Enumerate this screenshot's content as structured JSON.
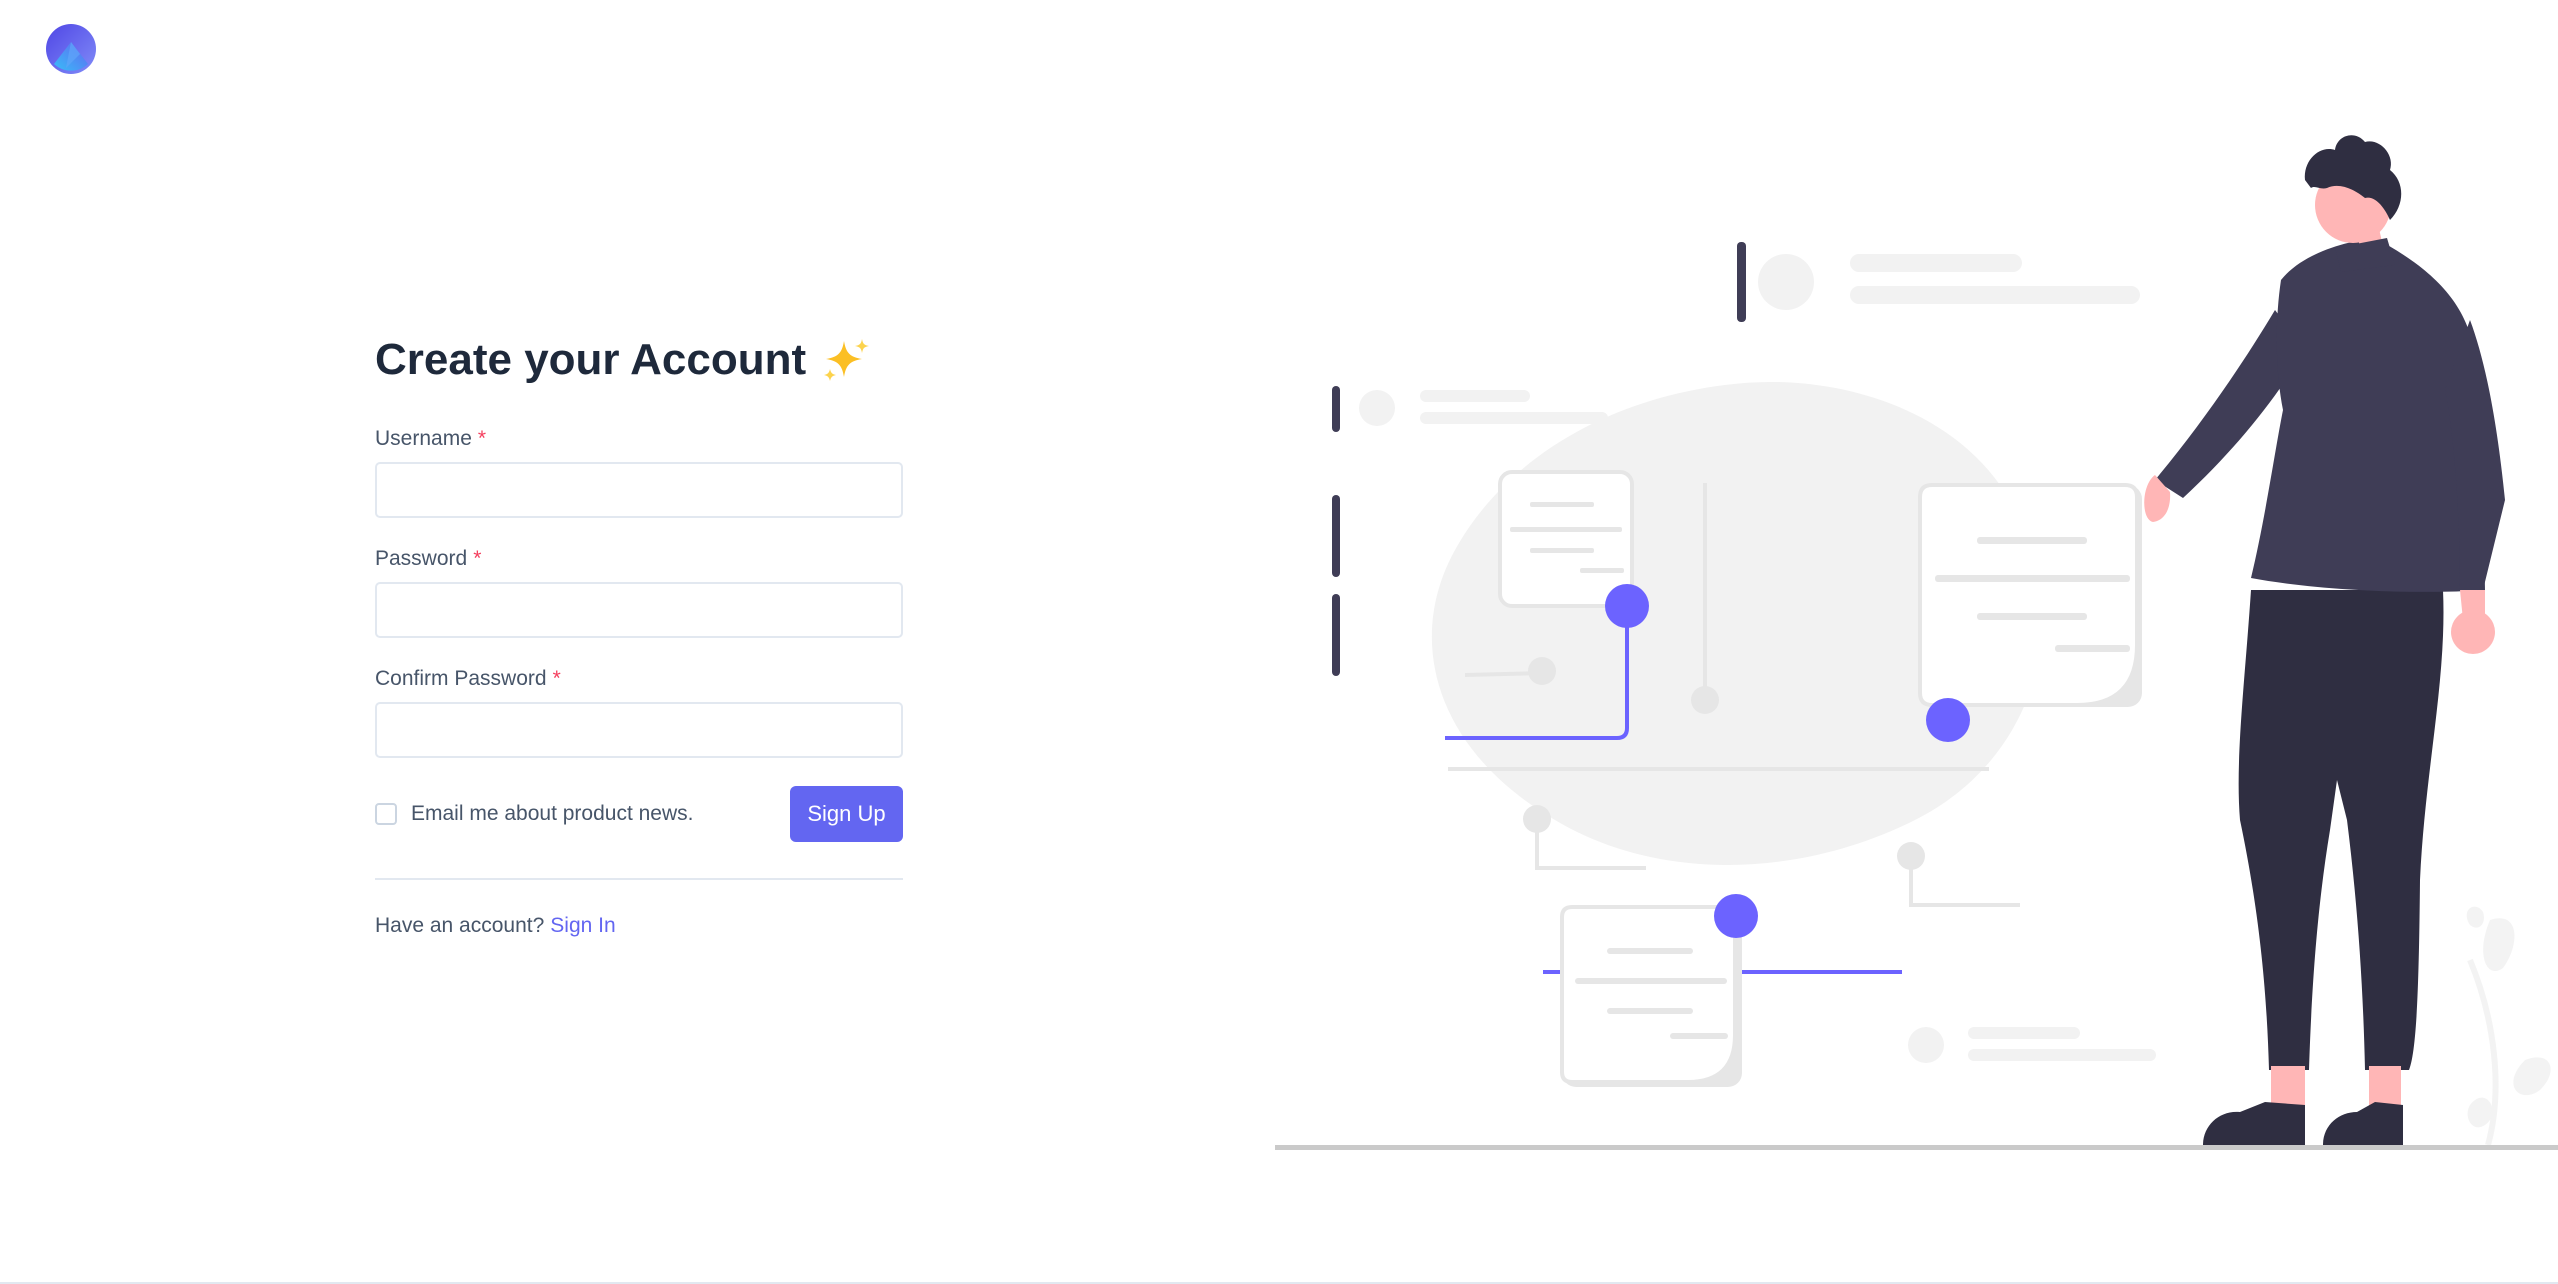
{
  "brand": {
    "logo_icon": "app-logo-icon",
    "gradient_start": "#6366f1",
    "gradient_end": "#38bdf8"
  },
  "form": {
    "title": "Create your Account",
    "title_emoji_icon": "sparkles-icon",
    "required_mark": "*",
    "fields": [
      {
        "label": "Username",
        "value": ""
      },
      {
        "label": "Password",
        "value": ""
      },
      {
        "label": "Confirm Password",
        "value": ""
      }
    ],
    "newsletter_label": "Email me about product news.",
    "newsletter_checked": false,
    "submit_label": "Sign Up",
    "footer_prompt": "Have an account?",
    "footer_link": "Sign In"
  },
  "colors": {
    "accent": "#6366f1",
    "required": "#f43f5e",
    "heading": "#1e293b",
    "text": "#475569",
    "border": "#e2e8f0",
    "illustration_dark": "#3f3d56",
    "illustration_skin": "#ffb6b6",
    "illustration_gray": "#f2f2f2"
  },
  "illustration": {
    "icon": "person-presenting-chart-illustration"
  }
}
